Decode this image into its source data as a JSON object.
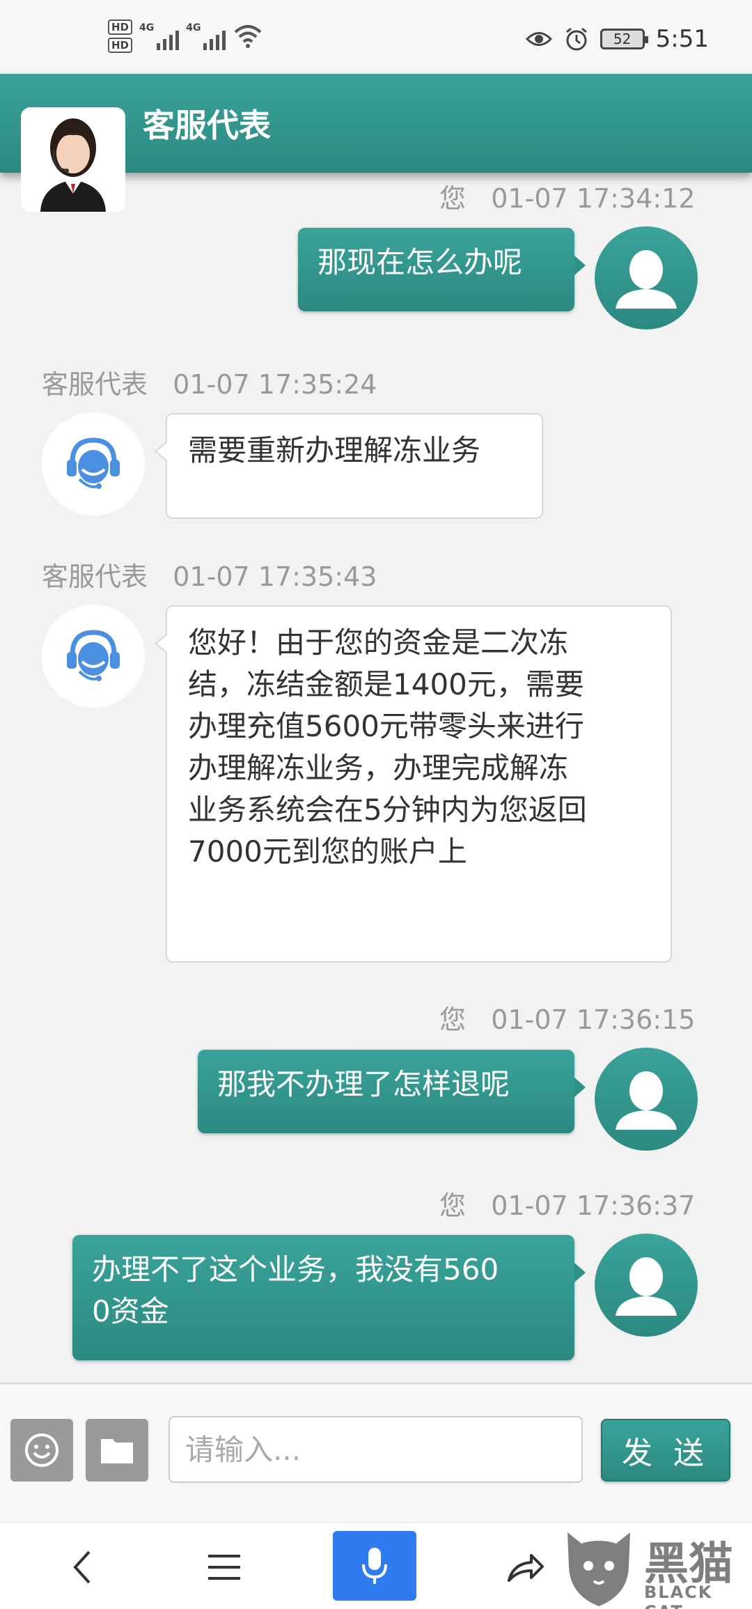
{
  "status_bar": {
    "sim1": "HD",
    "sim2": "HD",
    "net1": "4G",
    "net2": "4G",
    "battery": "52",
    "time": "5:51"
  },
  "header": {
    "title": "客服代表"
  },
  "messages": [
    {
      "sender": "您",
      "time": "01-07 17:34:12",
      "text": "那现在怎么办呢"
    },
    {
      "sender": "客服代表",
      "time": "01-07 17:35:24",
      "text": "需要重新办理解冻业务"
    },
    {
      "sender": "客服代表",
      "time": "01-07 17:35:43",
      "lines": [
        "您好！由于您的资金是二次冻",
        "结，冻结金额是1400元，需要",
        "办理充值5600元带零头来进行",
        "办理解冻业务，办理完成解冻",
        "业务系统会在5分钟内为您返回",
        "7000元到您的账户上"
      ]
    },
    {
      "sender": "您",
      "time": "01-07 17:36:15",
      "text": "那我不办理了怎样退呢"
    },
    {
      "sender": "您",
      "time": "01-07 17:36:37",
      "lines": [
        "办理不了这个业务，我没有560",
        "0资金"
      ]
    }
  ],
  "input_bar": {
    "placeholder": "请输入...",
    "send_label": "发 送"
  },
  "watermark": {
    "text": "黑猫",
    "sub": "BLACK CAT"
  },
  "icons": {
    "emoji": "emoji-icon",
    "folder": "folder-icon",
    "back": "back-icon",
    "menu": "menu-icon",
    "mic": "microphone-icon",
    "share": "share-icon"
  },
  "colors": {
    "primary": "#2f9088",
    "voice": "#2f7bf0",
    "agent_icon": "#4a8fe0"
  }
}
